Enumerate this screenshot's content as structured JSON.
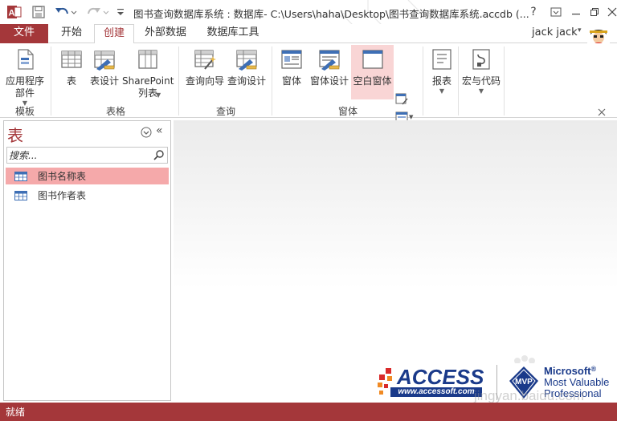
{
  "window": {
    "title": "图书查询数据库系统 : 数据库- C:\\Users\\haha\\Desktop\\图书查询数据库系统.accdb (...",
    "help_label": "?"
  },
  "tabs": [
    {
      "label": "文件"
    },
    {
      "label": "开始"
    },
    {
      "label": "创建"
    },
    {
      "label": "外部数据"
    },
    {
      "label": "数据库工具"
    }
  ],
  "active_tab": "创建",
  "user": {
    "name": "jack jack"
  },
  "ribbon": {
    "groups": [
      {
        "label": "模板",
        "buttons": [
          {
            "line1": "应用程序",
            "line2": "部件"
          }
        ]
      },
      {
        "label": "表格",
        "buttons": [
          {
            "line1": "表"
          },
          {
            "line1": "表设计"
          },
          {
            "line1": "SharePoint",
            "line2": "列表"
          }
        ]
      },
      {
        "label": "查询",
        "buttons": [
          {
            "line1": "查询向导"
          },
          {
            "line1": "查询设计"
          }
        ]
      },
      {
        "label": "窗体",
        "buttons": [
          {
            "line1": "窗体"
          },
          {
            "line1": "窗体设计"
          },
          {
            "line1": "空白窗体"
          }
        ]
      },
      {
        "label": "",
        "buttons": [
          {
            "line1": "报表"
          }
        ]
      },
      {
        "label": "",
        "buttons": [
          {
            "line1": "宏与代码"
          }
        ]
      }
    ]
  },
  "nav_pane": {
    "title": "表",
    "search_placeholder": "搜索...",
    "items": [
      {
        "label": "图书名称表",
        "selected": true
      },
      {
        "label": "图书作者表",
        "selected": false
      }
    ]
  },
  "status": {
    "text": "就绪"
  },
  "watermark": {
    "access": "ACCESS",
    "access_url": "www.accessoft.com",
    "mvp_badge": "MVP",
    "microsoft": "Microsoft",
    "registered": "®",
    "mvp_line1": "Most Valuable",
    "mvp_line2": "Professional",
    "site": "jingyan.baidu.com"
  },
  "colors": {
    "accent": "#a4373a",
    "selected_item": "#f5a9aa",
    "highlight_button": "#f9d5d5",
    "logo_blue": "#1a3a8a"
  }
}
